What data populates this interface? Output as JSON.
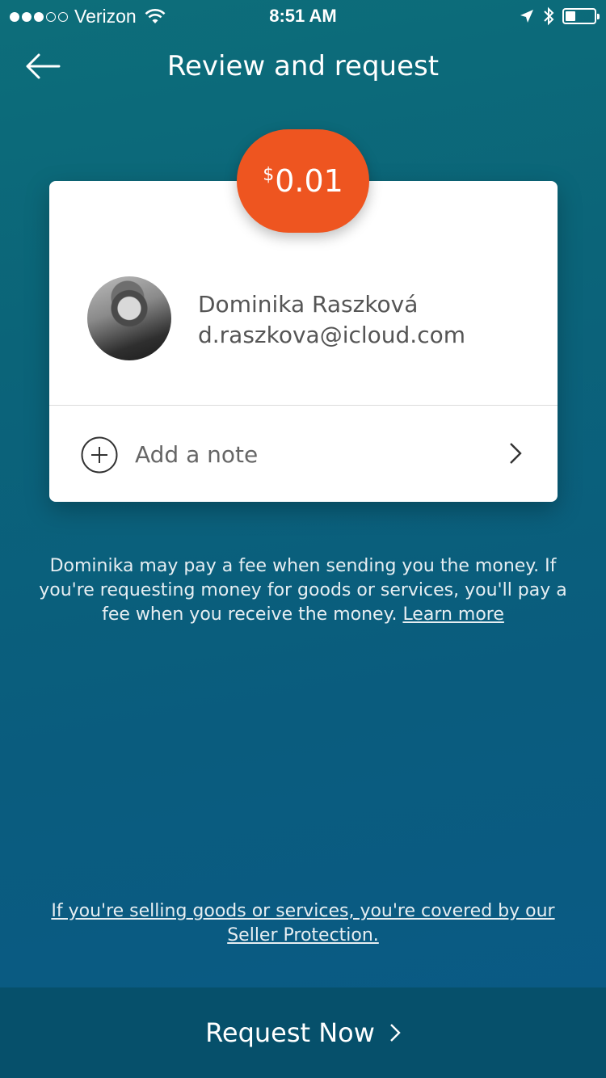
{
  "status_bar": {
    "carrier": "Verizon",
    "time": "8:51 AM",
    "signal_bars_filled": 3,
    "signal_bars_total": 5,
    "battery_level": 0.35
  },
  "nav": {
    "title": "Review and request",
    "back_icon": "arrow-left-icon"
  },
  "amount": {
    "currency_symbol": "$",
    "value": "0.01"
  },
  "contact": {
    "name": "Dominika Raszková",
    "email": "d.raszkova@icloud.com"
  },
  "note": {
    "label": "Add a note"
  },
  "fee_notice": {
    "text": "Dominika may pay a fee when sending you the money. If you're requesting money for goods or services, you'll pay a fee when you receive the money.",
    "link": "Learn more"
  },
  "seller_protection": {
    "link": "If you're selling goods or services, you're covered by our Seller Protection."
  },
  "action": {
    "label": "Request Now"
  },
  "colors": {
    "accent": "#ee5520",
    "background_top": "#0d6e7a",
    "background_bottom": "#0a5a86",
    "bottom_bar": "#06506b"
  }
}
